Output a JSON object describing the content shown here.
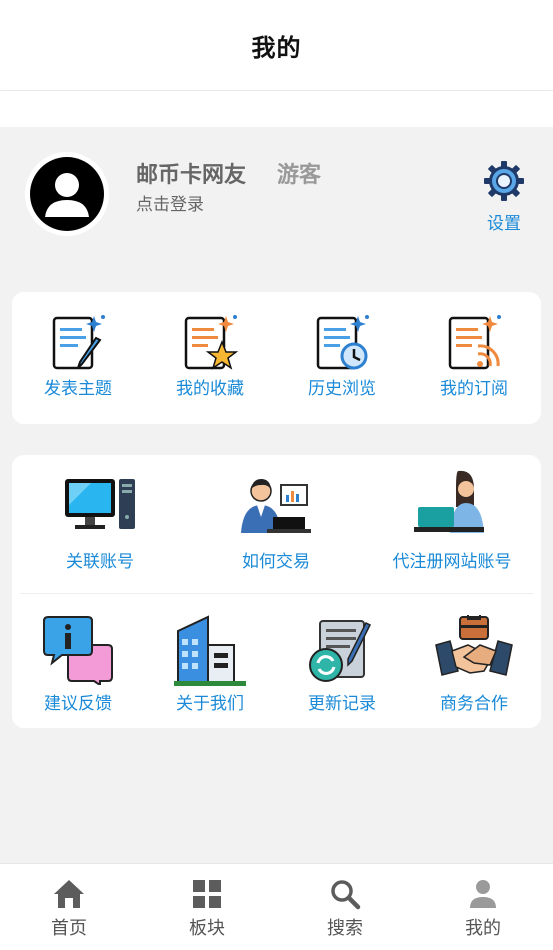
{
  "header": {
    "title": "我的"
  },
  "profile": {
    "username": "邮币卡网友",
    "role": "游客",
    "login_prompt": "点击登录",
    "settings_label": "设置"
  },
  "quick_actions": [
    {
      "label": "发表主题",
      "icon": "post-topic-icon"
    },
    {
      "label": "我的收藏",
      "icon": "favorites-icon"
    },
    {
      "label": "历史浏览",
      "icon": "history-icon"
    },
    {
      "label": "我的订阅",
      "icon": "subscription-icon"
    }
  ],
  "services_row1": [
    {
      "label": "关联账号",
      "icon": "computer-icon"
    },
    {
      "label": "如何交易",
      "icon": "trader-icon"
    },
    {
      "label": "代注册网站账号",
      "icon": "register-account-icon"
    }
  ],
  "services_row2": [
    {
      "label": "建议反馈",
      "icon": "feedback-icon"
    },
    {
      "label": "关于我们",
      "icon": "building-icon"
    },
    {
      "label": "更新记录",
      "icon": "update-log-icon"
    },
    {
      "label": "商务合作",
      "icon": "handshake-icon"
    }
  ],
  "tabbar": [
    {
      "label": "首页",
      "icon": "home-icon"
    },
    {
      "label": "板块",
      "icon": "grid-icon"
    },
    {
      "label": "搜索",
      "icon": "search-icon"
    },
    {
      "label": "我的",
      "icon": "user-icon"
    }
  ],
  "colors": {
    "accent": "#1a8ad8",
    "background": "#f2f2f2"
  }
}
